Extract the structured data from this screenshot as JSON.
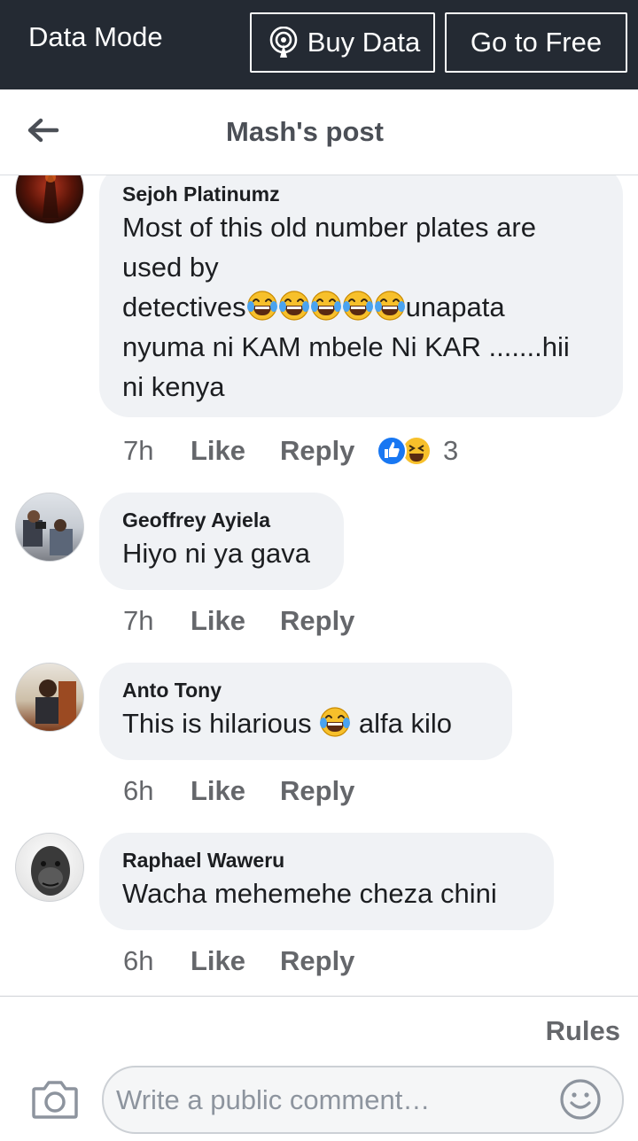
{
  "databar": {
    "mode_label": "Data Mode",
    "buy_label": "Buy Data",
    "free_label": "Go to Free"
  },
  "header": {
    "title": "Mash's post"
  },
  "comments": [
    {
      "author": "Sejoh Platinumz",
      "lines": [
        "Most of this old number plates are",
        "used by"
      ],
      "line3_before": "detectives",
      "line3_after": "unapata",
      "lines_after": [
        "nyuma ni KAM mbele Ni KAR .......hii",
        "ni kenya"
      ],
      "time": "7h",
      "like": "Like",
      "reply": "Reply",
      "reaction_count": "3"
    },
    {
      "author": "Geoffrey Ayiela",
      "text": "Hiyo ni ya gava",
      "time": "7h",
      "like": "Like",
      "reply": "Reply"
    },
    {
      "author": "Anto Tony",
      "text_before": "This is hilarious ",
      "text_after": " alfa kilo",
      "time": "6h",
      "like": "Like",
      "reply": "Reply"
    },
    {
      "author": "Raphael Waweru",
      "text": "Wacha mehemehe cheza chini",
      "time": "6h",
      "like": "Like",
      "reply": "Reply"
    }
  ],
  "composer": {
    "rules_label": "Rules",
    "placeholder": "Write a public comment…"
  },
  "icons": {
    "buy": "broadcast-icon",
    "back": "back-arrow-icon",
    "camera": "camera-icon",
    "emoji": "smiley-icon",
    "laugh": "tears-of-joy-emoji",
    "reactions": [
      "like-reaction-icon",
      "haha-reaction-icon"
    ]
  },
  "colors": {
    "databar_bg": "#242a33",
    "bubble_bg": "#f0f2f5",
    "muted_text": "#65676b",
    "like_blue": "#1877f2"
  }
}
